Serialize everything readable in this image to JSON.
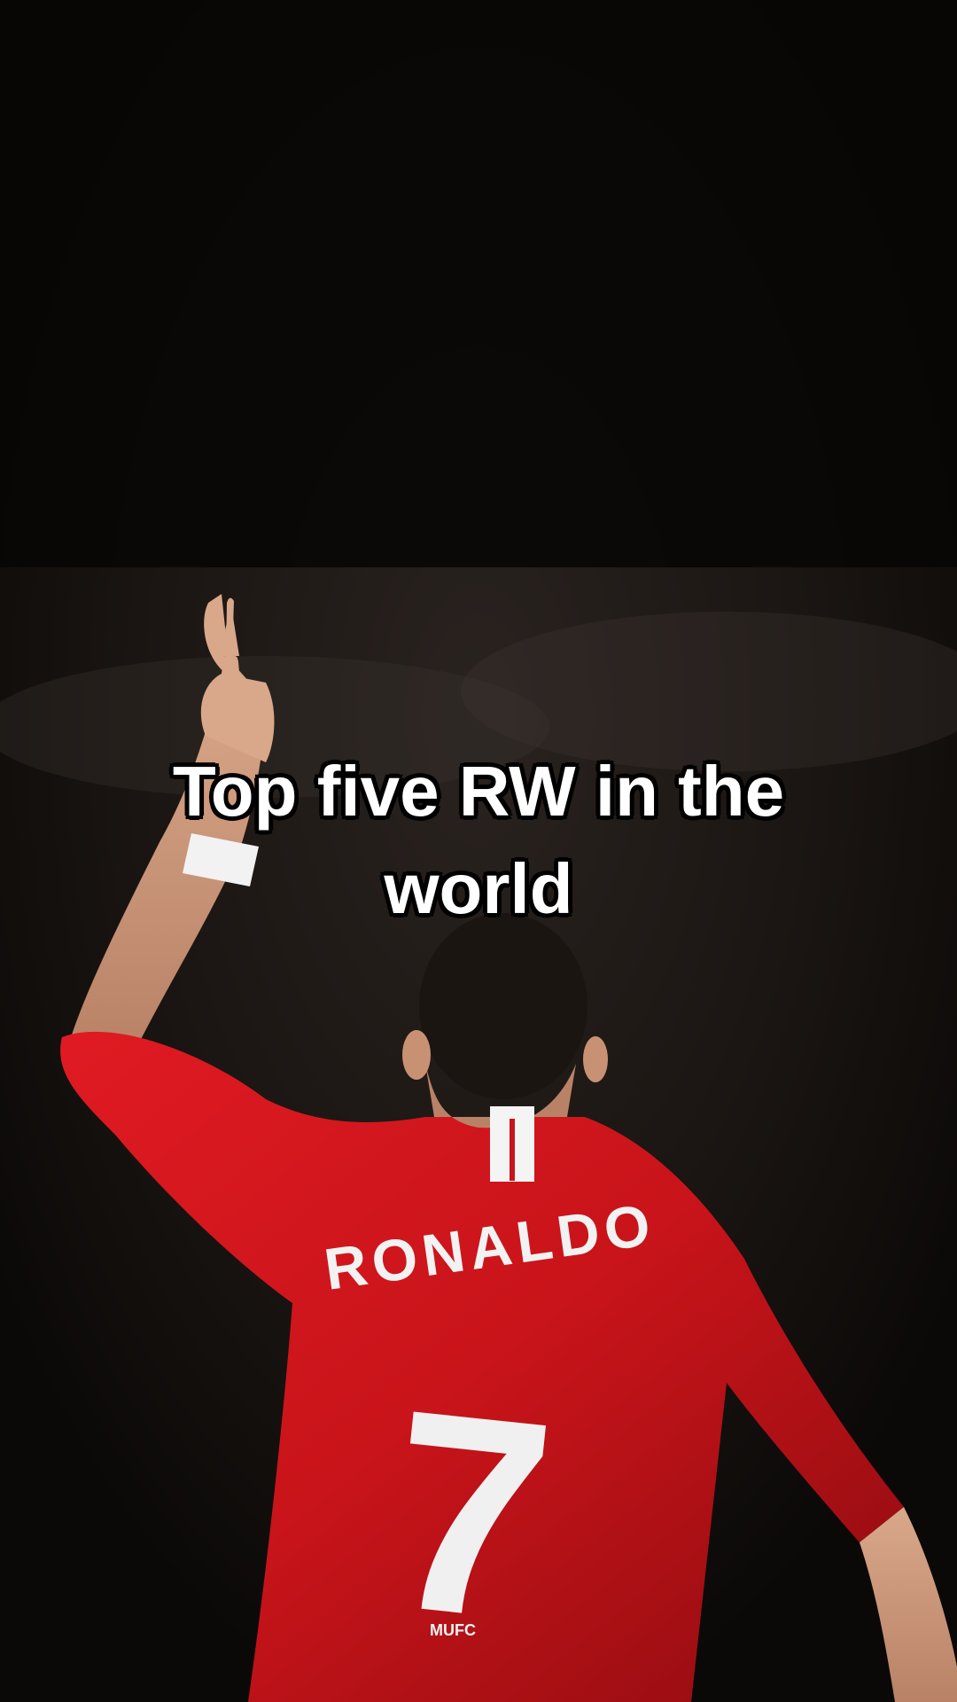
{
  "caption": {
    "line1": "Top five RW in the",
    "line2": "world"
  },
  "jersey": {
    "name": "RONALDO",
    "number": "7",
    "crest_text": "MUFC"
  },
  "colors": {
    "background": "#0b0908",
    "jersey_red": "#c8141a",
    "text": "#ffffff"
  }
}
